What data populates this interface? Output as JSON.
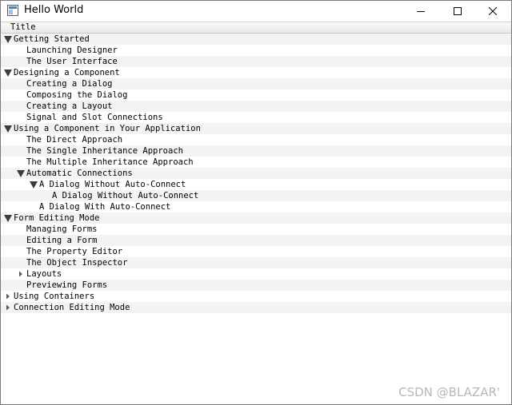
{
  "window": {
    "title": "Hello World",
    "icon": "app-window-icon",
    "controls": [
      "minimize-icon",
      "maximize-icon",
      "close-icon"
    ]
  },
  "tree": {
    "header_title": "Title",
    "items": [
      {
        "label": "Getting Started",
        "level": 0,
        "state": "expanded"
      },
      {
        "label": "Launching Designer",
        "level": 1,
        "state": "leaf"
      },
      {
        "label": "The User Interface",
        "level": 1,
        "state": "leaf"
      },
      {
        "label": "Designing a Component",
        "level": 0,
        "state": "expanded"
      },
      {
        "label": "Creating a Dialog",
        "level": 1,
        "state": "leaf"
      },
      {
        "label": "Composing the Dialog",
        "level": 1,
        "state": "leaf"
      },
      {
        "label": "Creating a Layout",
        "level": 1,
        "state": "leaf"
      },
      {
        "label": "Signal and Slot Connections",
        "level": 1,
        "state": "leaf"
      },
      {
        "label": "Using a Component in Your Application",
        "level": 0,
        "state": "expanded"
      },
      {
        "label": "The Direct Approach",
        "level": 1,
        "state": "leaf"
      },
      {
        "label": "The Single Inheritance Approach",
        "level": 1,
        "state": "leaf"
      },
      {
        "label": "The Multiple Inheritance Approach",
        "level": 1,
        "state": "leaf"
      },
      {
        "label": "Automatic Connections",
        "level": 1,
        "state": "expanded"
      },
      {
        "label": "A Dialog Without Auto-Connect",
        "level": 2,
        "state": "expanded"
      },
      {
        "label": "A Dialog Without Auto-Connect",
        "level": 3,
        "state": "leaf"
      },
      {
        "label": "A Dialog With Auto-Connect",
        "level": 2,
        "state": "leaf"
      },
      {
        "label": "Form Editing Mode",
        "level": 0,
        "state": "expanded"
      },
      {
        "label": "Managing Forms",
        "level": 1,
        "state": "leaf"
      },
      {
        "label": "Editing a Form",
        "level": 1,
        "state": "leaf"
      },
      {
        "label": "The Property Editor",
        "level": 1,
        "state": "leaf"
      },
      {
        "label": "The Object Inspector",
        "level": 1,
        "state": "leaf"
      },
      {
        "label": "Layouts",
        "level": 1,
        "state": "collapsed"
      },
      {
        "label": "Previewing Forms",
        "level": 1,
        "state": "leaf"
      },
      {
        "label": "Using Containers",
        "level": 0,
        "state": "collapsed"
      },
      {
        "label": "Connection Editing Mode",
        "level": 0,
        "state": "collapsed"
      }
    ]
  },
  "watermark": "CSDN @BLAZAR'"
}
